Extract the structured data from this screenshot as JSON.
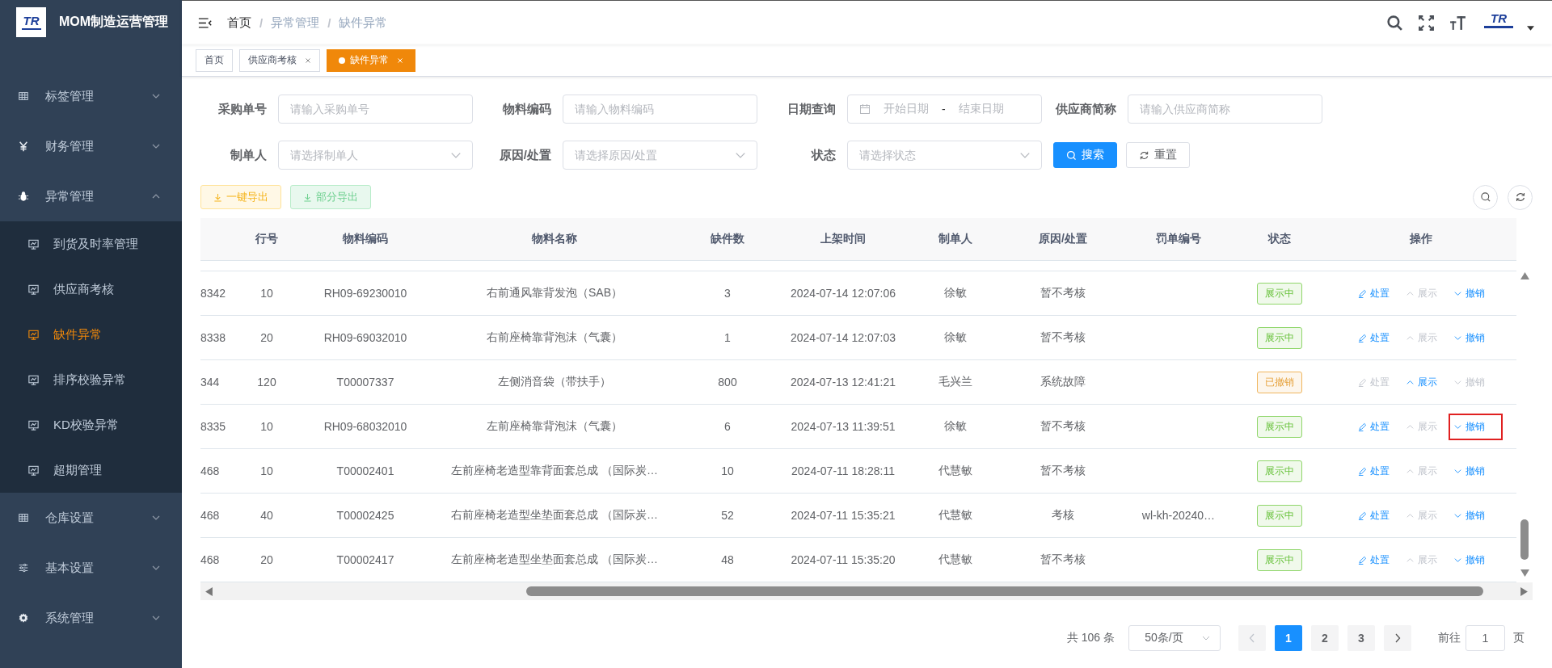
{
  "app": {
    "logo_mark": "TR",
    "title": "MOM制造运营管理"
  },
  "sidebar": {
    "items": [
      {
        "label": "标签管理",
        "kind": "table",
        "expanded": false
      },
      {
        "label": "财务管理",
        "kind": "yen",
        "expanded": false
      },
      {
        "label": "异常管理",
        "kind": "bug",
        "expanded": true,
        "children": [
          {
            "label": "到货及时率管理",
            "selected": false
          },
          {
            "label": "供应商考核",
            "selected": false
          },
          {
            "label": "缺件异常",
            "selected": true
          },
          {
            "label": "排序校验异常",
            "selected": false
          },
          {
            "label": "KD校验异常",
            "selected": false
          },
          {
            "label": "超期管理",
            "selected": false
          }
        ]
      },
      {
        "label": "仓库设置",
        "kind": "table",
        "expanded": false
      },
      {
        "label": "基本设置",
        "kind": "sliders",
        "expanded": false
      },
      {
        "label": "系统管理",
        "kind": "gear",
        "expanded": false
      }
    ]
  },
  "header": {
    "breadcrumb": [
      "首页",
      "异常管理",
      "缺件异常"
    ],
    "breadcrumb_separator": "/",
    "avatar_mark": "TR"
  },
  "tabs": [
    {
      "label": "首页",
      "selected": false,
      "closable": false
    },
    {
      "label": "供应商考核",
      "selected": false,
      "closable": true
    },
    {
      "label": "缺件异常",
      "selected": true,
      "closable": true
    }
  ],
  "filters": [
    {
      "label": "采购单号",
      "kind": "text",
      "placeholder": "请输入采购单号"
    },
    {
      "label": "物料编码",
      "kind": "text",
      "placeholder": "请输入物料编码"
    },
    {
      "label": "日期查询",
      "kind": "daterange",
      "start_placeholder": "开始日期",
      "separator": "-",
      "end_placeholder": "结束日期"
    },
    {
      "label": "供应商简称",
      "kind": "text",
      "placeholder": "请输入供应商简称"
    },
    {
      "label": "制单人",
      "kind": "select",
      "placeholder": "请选择制单人"
    },
    {
      "label": "原因/处置",
      "kind": "select",
      "placeholder": "请选择原因/处置"
    },
    {
      "label": "状态",
      "kind": "select",
      "placeholder": "请选择状态"
    }
  ],
  "filter_buttons": {
    "search": "搜索",
    "reset": "重置"
  },
  "toolbar": [
    {
      "label": "一键导出",
      "kind": "warning"
    },
    {
      "label": "部分导出",
      "kind": "success"
    }
  ],
  "table": {
    "columns": [
      "行号",
      "物料编码",
      "物料名称",
      "缺件数",
      "上架时间",
      "制单人",
      "原因/处置",
      "罚单编号",
      "状态",
      "操作"
    ],
    "rows": [
      {
        "column_1": "8342",
        "line_no": "10",
        "material_code": "RH09-69230010",
        "material_name": "右前通风靠背发泡（SAB）",
        "shortage_qty": "3",
        "shelved_at": "2024-07-14 12:07:06",
        "creator": "徐敏",
        "reason": "暂不考核",
        "status": {
          "label": "展示中",
          "kind": "active"
        },
        "actions": [
          {
            "label": "处置",
            "kind": "edit",
            "disabled": false
          },
          {
            "label": "展示",
            "kind": "up",
            "disabled": true
          },
          {
            "label": "撤销",
            "kind": "down",
            "disabled": false,
            "highlighted": false
          }
        ]
      },
      {
        "column_1": "8338",
        "line_no": "20",
        "material_code": "RH09-69032010",
        "material_name": "右前座椅靠背泡沫（气囊）",
        "shortage_qty": "1",
        "shelved_at": "2024-07-14 12:07:03",
        "creator": "徐敏",
        "reason": "暂不考核",
        "status": {
          "label": "展示中",
          "kind": "active"
        },
        "actions": [
          {
            "label": "处置",
            "kind": "edit",
            "disabled": false
          },
          {
            "label": "展示",
            "kind": "up",
            "disabled": true
          },
          {
            "label": "撤销",
            "kind": "down",
            "disabled": false,
            "highlighted": false
          }
        ]
      },
      {
        "column_1": "344",
        "line_no": "120",
        "material_code": "T00007337",
        "material_name": "左侧消音袋（带扶手）",
        "shortage_qty": "800",
        "shelved_at": "2024-07-13 12:41:21",
        "creator": "毛兴兰",
        "reason": "系统故障",
        "status": {
          "label": "已撤销",
          "kind": "revoked"
        },
        "actions": [
          {
            "label": "处置",
            "kind": "edit",
            "disabled": true
          },
          {
            "label": "展示",
            "kind": "up",
            "disabled": false
          },
          {
            "label": "撤销",
            "kind": "down",
            "disabled": true,
            "highlighted": false
          }
        ]
      },
      {
        "column_1": "8335",
        "line_no": "10",
        "material_code": "RH09-68032010",
        "material_name": "左前座椅靠背泡沫（气囊）",
        "shortage_qty": "6",
        "shelved_at": "2024-07-13 11:39:51",
        "creator": "徐敏",
        "reason": "暂不考核",
        "status": {
          "label": "展示中",
          "kind": "active"
        },
        "actions": [
          {
            "label": "处置",
            "kind": "edit",
            "disabled": false
          },
          {
            "label": "展示",
            "kind": "up",
            "disabled": true
          },
          {
            "label": "撤销",
            "kind": "down",
            "disabled": false,
            "highlighted": true
          }
        ]
      },
      {
        "column_1": "468",
        "line_no": "10",
        "material_code": "T00002401",
        "material_name": "左前座椅老造型靠背面套总成 （国际炭…",
        "shortage_qty": "10",
        "shelved_at": "2024-07-11 18:28:11",
        "creator": "代慧敏",
        "reason": "暂不考核",
        "status": {
          "label": "展示中",
          "kind": "active"
        },
        "actions": [
          {
            "label": "处置",
            "kind": "edit",
            "disabled": false
          },
          {
            "label": "展示",
            "kind": "up",
            "disabled": true
          },
          {
            "label": "撤销",
            "kind": "down",
            "disabled": false,
            "highlighted": false
          }
        ]
      },
      {
        "column_1": "468",
        "line_no": "40",
        "material_code": "T00002425",
        "material_name": "右前座椅老造型坐垫面套总成 （国际炭…",
        "shortage_qty": "52",
        "shelved_at": "2024-07-11 15:35:21",
        "creator": "代慧敏",
        "reason": "考核",
        "penalty_no": "wl-kh-20240…",
        "status": {
          "label": "展示中",
          "kind": "active"
        },
        "actions": [
          {
            "label": "处置",
            "kind": "edit",
            "disabled": false
          },
          {
            "label": "展示",
            "kind": "up",
            "disabled": true
          },
          {
            "label": "撤销",
            "kind": "down",
            "disabled": false,
            "highlighted": false
          }
        ]
      },
      {
        "column_1": "468",
        "line_no": "20",
        "material_code": "T00002417",
        "material_name": "左前座椅老造型坐垫面套总成 （国际炭…",
        "shortage_qty": "48",
        "shelved_at": "2024-07-11 15:35:20",
        "creator": "代慧敏",
        "reason": "暂不考核",
        "status": {
          "label": "展示中",
          "kind": "active"
        },
        "actions": [
          {
            "label": "处置",
            "kind": "edit",
            "disabled": false
          },
          {
            "label": "展示",
            "kind": "up",
            "disabled": true
          },
          {
            "label": "撤销",
            "kind": "down",
            "disabled": false,
            "highlighted": false
          }
        ]
      }
    ]
  },
  "pagination": {
    "total": "共 106 条",
    "page_size": "50条/页",
    "pages": [
      {
        "label": "1",
        "selected": true
      },
      {
        "label": "2",
        "selected": false
      },
      {
        "label": "3",
        "selected": false
      }
    ],
    "goto_label": "前往",
    "goto_value": "1",
    "page_unit": "页"
  }
}
